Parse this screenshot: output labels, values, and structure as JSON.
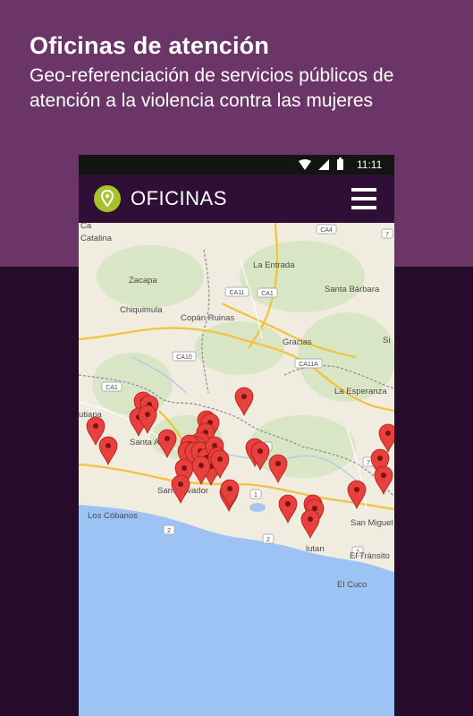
{
  "colors": {
    "banner": "#6b3567",
    "background": "#260b2a",
    "app_bar": "#2f0f35",
    "accent": "#a9c12a",
    "marker": "#e8403d",
    "land": "#f0ece0",
    "sea": "#9dc3f5"
  },
  "promo": {
    "title": "Oficinas de atención",
    "subtitle": "Geo-referenciación de servicios públicos de atención a la violencia contra las mujeres"
  },
  "status_bar": {
    "time": "11:11",
    "icons": [
      "wifi-icon",
      "signal-icon",
      "battery-icon"
    ]
  },
  "app_bar": {
    "logo_icon": "location-pin-icon",
    "title": "OFICINAS",
    "menu_icon": "hamburger-menu-icon"
  },
  "map": {
    "places": [
      "Catalina",
      "Zacapa",
      "Chiquimula",
      "Copán Ruinas",
      "La Entrada",
      "Santa Bárbara",
      "Gracias",
      "La Esperanza",
      "Jutiapa",
      "Santa Ana",
      "San Salvador",
      "Los Cóbanos",
      "San Miguel",
      "Usulután",
      "El Tránsito",
      "El Cuco"
    ],
    "place_fragments": {
      "left_top": "Ca",
      "jutiapa": "utiapa",
      "usulutan": "lutan",
      "sansalvador": "San Salvador",
      "sanmiguel": "San Miguel",
      "si": "Si"
    },
    "road_shields": [
      "CA4",
      "CA11",
      "CA10",
      "CA1",
      "CA11A",
      "CA1",
      "2",
      "3",
      "1",
      "2",
      "2",
      "7",
      "7"
    ],
    "marker_icon": "map-marker-icon",
    "marker_count": 38
  }
}
